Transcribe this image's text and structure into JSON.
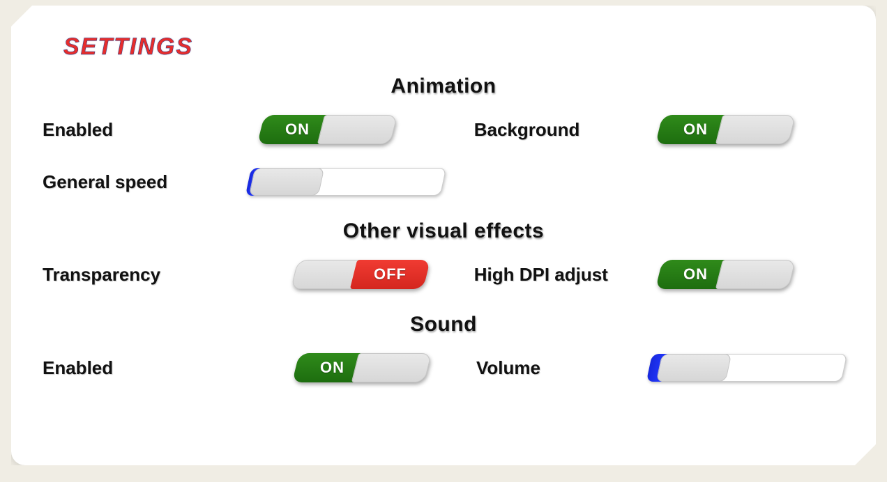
{
  "page_title": "SETTINGS",
  "toggle_labels": {
    "on": "ON",
    "off": "OFF"
  },
  "sections": {
    "animation": {
      "title": "Animation",
      "enabled": {
        "label": "Enabled",
        "state": "on"
      },
      "background": {
        "label": "Background",
        "state": "on"
      },
      "general_speed": {
        "label": "General speed",
        "value": 3,
        "min": 0,
        "max": 100
      }
    },
    "visual": {
      "title": "Other visual effects",
      "transparency": {
        "label": "Transparency",
        "state": "off"
      },
      "high_dpi": {
        "label": "High DPI adjust",
        "state": "on"
      }
    },
    "sound": {
      "title": "Sound",
      "enabled": {
        "label": "Enabled",
        "state": "on"
      },
      "volume": {
        "label": "Volume",
        "value": 8,
        "min": 0,
        "max": 100
      }
    }
  },
  "colors": {
    "on": "#237c10",
    "off": "#e6342b",
    "title": "#e62d2d",
    "slider_fill": "#1f2ee0"
  }
}
